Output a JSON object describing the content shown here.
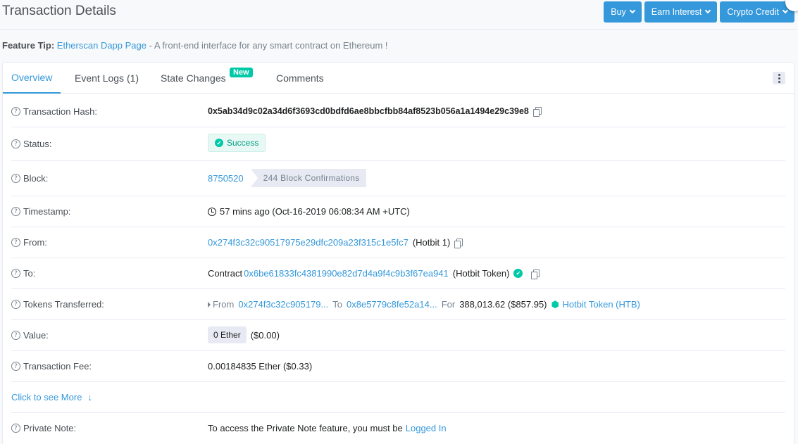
{
  "header": {
    "title": "Transaction Details",
    "buttons": [
      "Buy",
      "Earn Interest",
      "Crypto Credit"
    ]
  },
  "tip": {
    "prefix": "Feature Tip:",
    "link": "Etherscan Dapp Page",
    "text": "- A front-end interface for any smart contract on Ethereum !"
  },
  "tabs": {
    "overview": "Overview",
    "event_logs": "Event Logs (1)",
    "state_changes": "State Changes",
    "new_badge": "New",
    "comments": "Comments"
  },
  "rows": {
    "hash_label": "Transaction Hash:",
    "hash_value": "0x5ab34d9c02a34d6f3693cd0bdfd6ae8bbcfbb84af8523b056a1a1494e29c39e8",
    "status_label": "Status:",
    "status_value": "Success",
    "block_label": "Block:",
    "block_value": "8750520",
    "block_confirmations": "244 Block Confirmations",
    "timestamp_label": "Timestamp:",
    "timestamp_value": "57 mins ago (Oct-16-2019 06:08:34 AM +UTC)",
    "from_label": "From:",
    "from_address": "0x274f3c32c90517975e29dfc209a23f315c1e5fc7",
    "from_name": "(Hotbit 1)",
    "to_label": "To:",
    "to_prefix": "Contract",
    "to_address": "0x6be61833fc4381990e82d7d4a9f4c9b3f67ea941",
    "to_name": "(Hotbit Token)",
    "tokens_label": "Tokens Transferred:",
    "tokens_from_word": "From",
    "tokens_from": "0x274f3c32c905179...",
    "tokens_to_word": "To",
    "tokens_to": "0x8e5779c8fe52a14...",
    "tokens_for_word": "For",
    "tokens_amount": "388,013.62 ($857.95)",
    "tokens_name": "Hotbit Token (HTB)",
    "value_label": "Value:",
    "value_ether": "0 Ether",
    "value_usd": "($0.00)",
    "fee_label": "Transaction Fee:",
    "fee_value": "0.00184835 Ether ($0.33)",
    "see_more": "Click to see More",
    "note_label": "Private Note:",
    "note_text": "To access the Private Note feature, you must be",
    "note_link": "Logged In"
  },
  "colors": {
    "link": "#3498db",
    "success": "#00c9a7",
    "text": "#1e2022"
  }
}
